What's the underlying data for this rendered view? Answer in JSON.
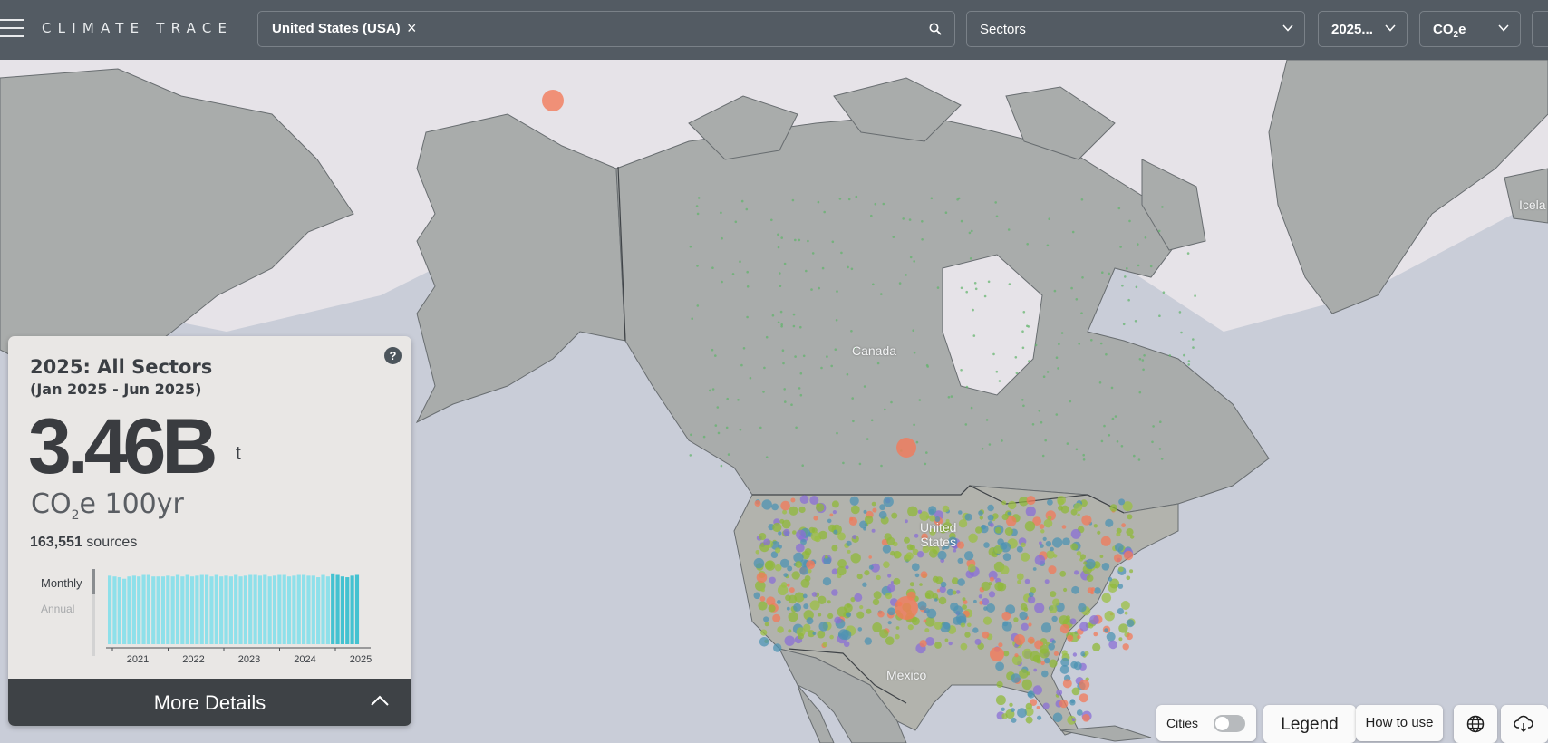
{
  "header": {
    "menu_icon": "hamburger-menu-icon",
    "brand": "CLIMATE TRACE",
    "search": {
      "chip": "United States (USA)",
      "clear_icon": "close-icon",
      "icon": "search-icon"
    },
    "sectors_label": "Sectors",
    "year_label": "2025...",
    "gas_label": "CO",
    "gas_sub": "2",
    "gas_suffix": "e"
  },
  "map": {
    "labels": {
      "canada": "Canada",
      "us_line1": "United",
      "us_line2": "States",
      "mexico": "Mexico",
      "iceland": "Icela"
    },
    "colors": {
      "ocean": "#c9cdd8",
      "land": "#a9acab",
      "ice": "#e8e6ea",
      "border": "#3f4347"
    }
  },
  "panel": {
    "help_icon": "question-icon",
    "title": "2025: All Sectors",
    "range": "(Jan 2025 - Jun 2025)",
    "total": "3.46B",
    "unit": "t",
    "gas": "CO",
    "gas_sub": "2",
    "gas_suffix": "e 100yr",
    "sources_count": "163,551",
    "sources_label": "sources",
    "toggle_monthly": "Monthly",
    "toggle_annual": "Annual",
    "more_details": "More Details",
    "more_icon": "chevron-up-icon"
  },
  "chart_data": {
    "type": "bar",
    "title": "",
    "xlabel": "",
    "ylabel": "",
    "x_tick_labels": [
      "2021",
      "2022",
      "2023",
      "2024",
      "2025"
    ],
    "series": [
      {
        "values": [
          0.89,
          0.88,
          0.87,
          0.85,
          0.88,
          0.89,
          0.88,
          0.9,
          0.9,
          0.88,
          0.88,
          0.88,
          0.89,
          0.88,
          0.9,
          0.88,
          0.9,
          0.88,
          0.89,
          0.9,
          0.9,
          0.88,
          0.9,
          0.88,
          0.89,
          0.88,
          0.9,
          0.88,
          0.89,
          0.9,
          0.9,
          0.89,
          0.9,
          0.88,
          0.89,
          0.9,
          0.9,
          0.88,
          0.89,
          0.9,
          0.9,
          0.89,
          0.89,
          0.87,
          0.9,
          0.88,
          0.92,
          0.9,
          0.88,
          0.87,
          0.89,
          0.9
        ]
      }
    ],
    "highlighted_from_index": 46,
    "colors": {
      "bar": "#8ee0ea",
      "highlight": "#44c2d1"
    }
  },
  "controls": {
    "cities_label": "Cities",
    "legend_label": "Legend",
    "how_label": "How to use",
    "globe_icon": "globe-icon",
    "download_icon": "cloud-download-icon"
  }
}
